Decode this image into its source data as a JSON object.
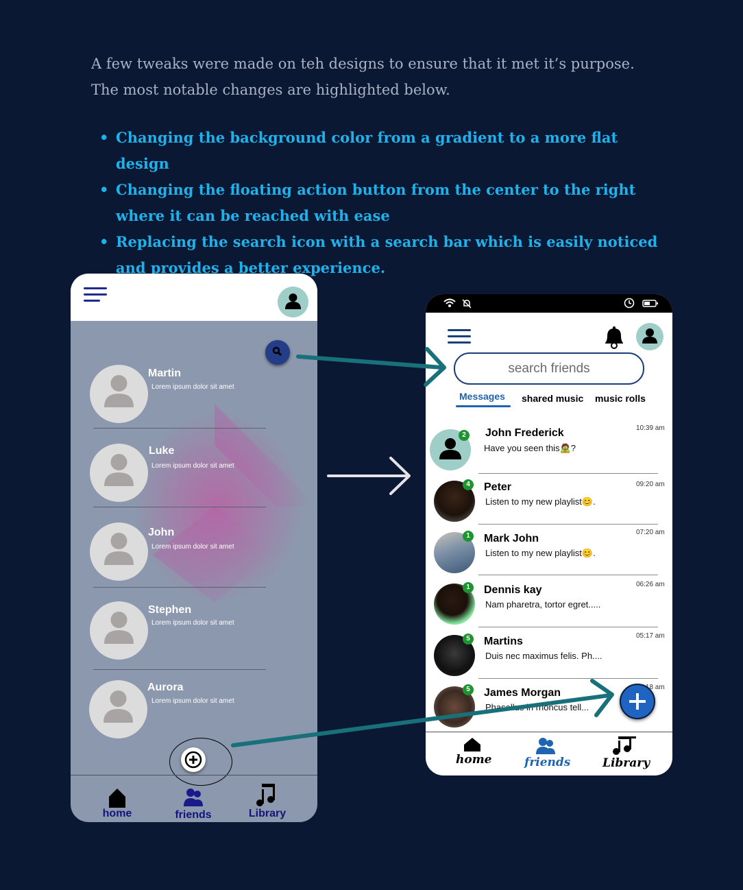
{
  "intro": {
    "line1": "A few tweaks were made on teh designs to ensure that it met it’s purpose.",
    "line2": "The most notable changes are highlighted below."
  },
  "bullets": [
    "Changing the background color from a gradient to a more flat design",
    "Changing the floating action button from the center to the right where it can be reached with ease",
    "Replacing the search icon with a search bar which is easily noticed and provides a better experience."
  ],
  "old_design": {
    "contacts": [
      {
        "name": "Martin",
        "preview": "Lorem ipsum dolor sit amet"
      },
      {
        "name": "Luke",
        "preview": "Lorem ipsum dolor sit amet"
      },
      {
        "name": "John",
        "preview": "Lorem ipsum dolor sit amet"
      },
      {
        "name": "Stephen",
        "preview": "Lorem ipsum dolor sit amet"
      },
      {
        "name": "Aurora",
        "preview": "Lorem ipsum dolor sit amet"
      }
    ],
    "nav": {
      "home": "home",
      "friends": "friends",
      "library": "Library"
    }
  },
  "new_design": {
    "search_placeholder": "search friends",
    "tabs": [
      "Messages",
      "shared music",
      "music rolls"
    ],
    "messages": [
      {
        "name": "John Frederick",
        "text": "Have you seen this🧟?",
        "time": "10:39 am",
        "badge": "2",
        "avatar": "avatar-placeholder"
      },
      {
        "name": "Peter",
        "text": "Listen to my new playlist😊.",
        "time": "09:20 am",
        "badge": "4",
        "avatar": "photo"
      },
      {
        "name": "Mark John",
        "text": "Listen to my new playlist😊.",
        "time": "07:20 am",
        "badge": "1",
        "avatar": "photo"
      },
      {
        "name": "Dennis kay",
        "text": "Nam pharetra, tortor egret.....",
        "time": "06:26 am",
        "badge": "1",
        "avatar": "photo"
      },
      {
        "name": "Martins",
        "text": "Duis nec maximus felis. Ph....",
        "time": "05:17 am",
        "badge": "5",
        "avatar": "photo"
      },
      {
        "name": "James Morgan",
        "text": "Phasellus in rhoncus tell...",
        "time": "04:18 am",
        "badge": "5",
        "avatar": "photo"
      }
    ],
    "nav": {
      "home": "home",
      "friends": "friends",
      "library": "Library"
    }
  },
  "colors": {
    "background": "#0b1833",
    "accent_text": "#1fb2ea",
    "arrow": "#17707a",
    "active_tab": "#1f64b0",
    "badge": "#1e9431"
  }
}
